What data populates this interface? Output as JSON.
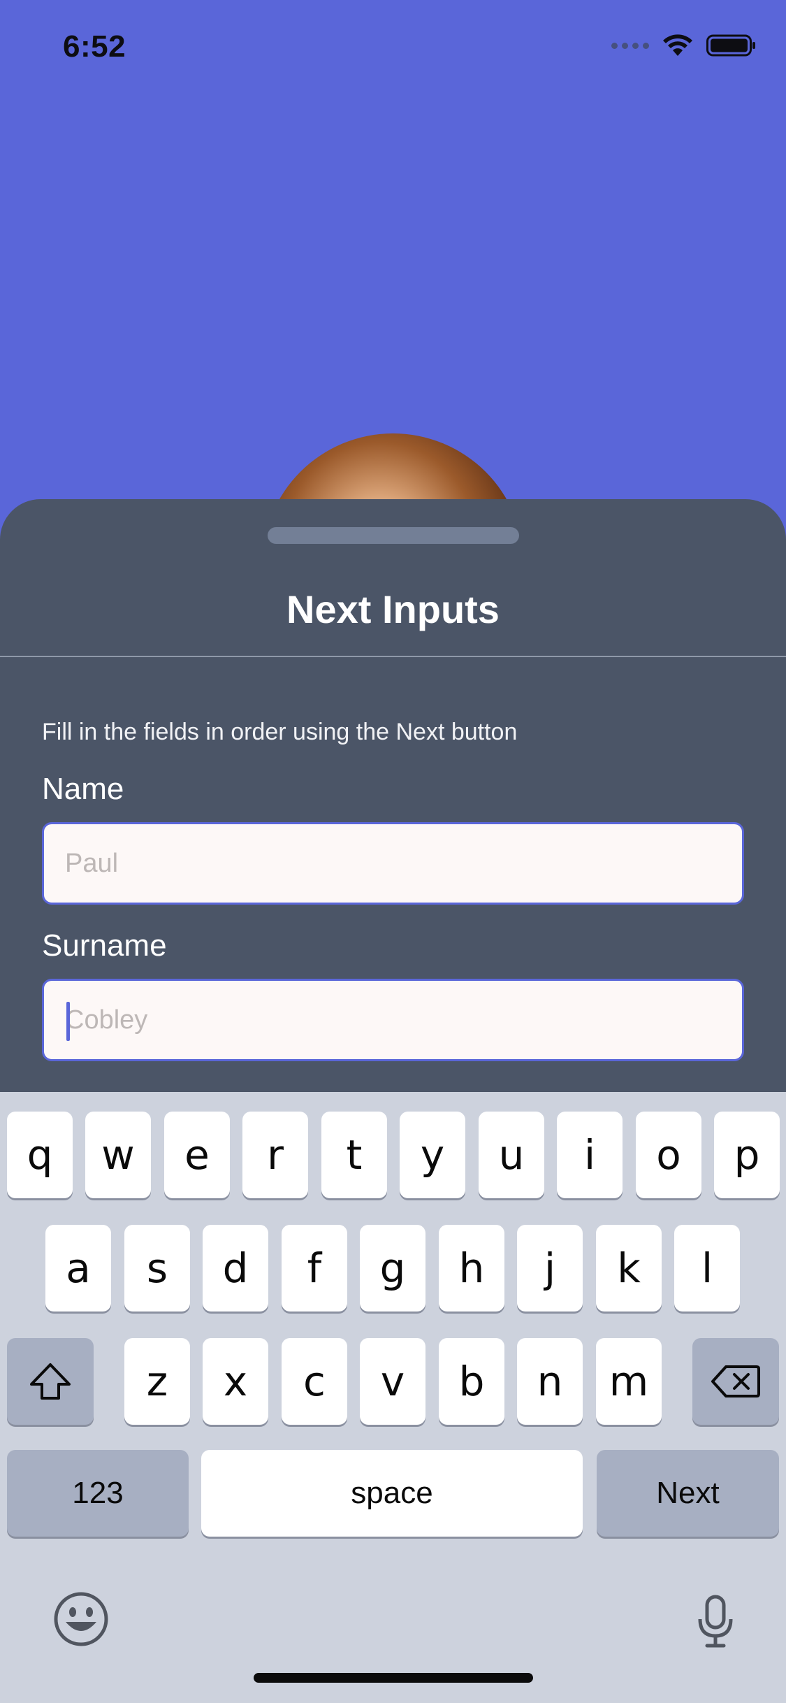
{
  "status_bar": {
    "time": "6:52"
  },
  "sheet": {
    "title": "Next Inputs",
    "hint": "Fill in the fields in order using the Next button",
    "name_label": "Name",
    "name_placeholder": "Paul",
    "surname_label": "Surname",
    "surname_placeholder": "Cobley"
  },
  "keyboard": {
    "row1": [
      "q",
      "w",
      "e",
      "r",
      "t",
      "y",
      "u",
      "i",
      "o",
      "p"
    ],
    "row2": [
      "a",
      "s",
      "d",
      "f",
      "g",
      "h",
      "j",
      "k",
      "l"
    ],
    "row3": [
      "z",
      "x",
      "c",
      "v",
      "b",
      "n",
      "m"
    ],
    "numbers_label": "123",
    "space_label": "space",
    "next_label": "Next"
  },
  "colors": {
    "background": "#5a66d9",
    "sheet": "#4b5567",
    "field_border": "#5a66d9",
    "keyboard": "#cdd2dd"
  },
  "icons": {
    "wifi": "wifi-icon",
    "battery": "battery-icon",
    "shift": "shift-icon",
    "backspace": "backspace-icon",
    "emoji": "emoji-icon",
    "microphone": "microphone-icon"
  }
}
